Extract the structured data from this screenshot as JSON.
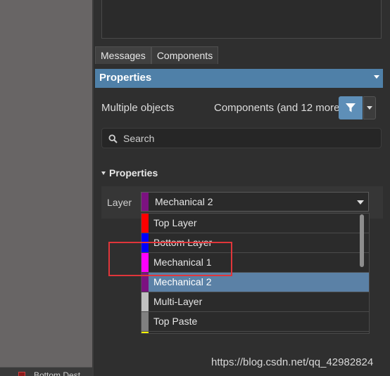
{
  "tabs": [
    "Messages",
    "Components"
  ],
  "properties_header": {
    "title": "Properties"
  },
  "selection": {
    "left": "Multiple objects",
    "right": "Components (and 12 more)"
  },
  "search": {
    "placeholder": "Search"
  },
  "section": {
    "title": "Properties"
  },
  "layer": {
    "label": "Layer",
    "selected": "Mechanical 2",
    "selected_color": "#7b1280",
    "options": [
      {
        "label": "Top Layer",
        "color": "#ff0000"
      },
      {
        "label": "Bottom Layer",
        "color": "#0000ff"
      },
      {
        "label": "Mechanical 1",
        "color": "#ff00ff"
      },
      {
        "label": "Mechanical 2",
        "color": "#7b1280",
        "selected": true
      },
      {
        "label": "Multi-Layer",
        "color": "#c0c0c0"
      },
      {
        "label": "Top Paste",
        "color": "#808080"
      }
    ]
  },
  "bottom_left": {
    "label": "Bottom Dest",
    "color": "#8a1b1b"
  },
  "watermark": "https://blog.csdn.net/qq_42982824"
}
